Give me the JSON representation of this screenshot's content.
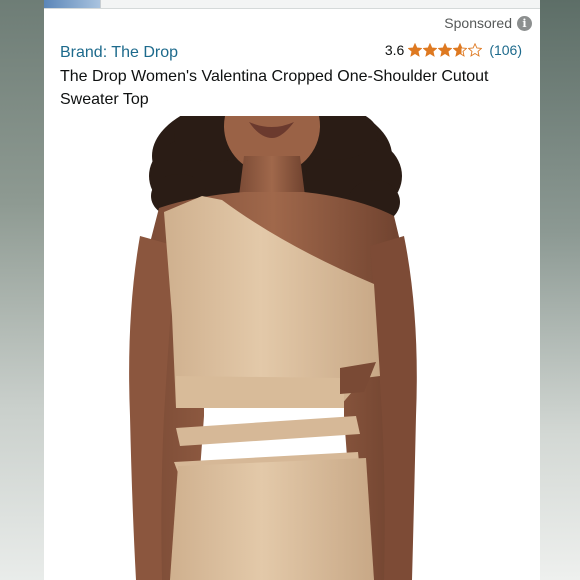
{
  "listing": {
    "sponsored_label": "Sponsored",
    "brand": "Brand: The Drop",
    "rating_value": "3.6",
    "rating_stars": 3.6,
    "review_count": "(106)",
    "title": "The Drop Women's Valentina Cropped One-Shoulder Cutout Sweater Top",
    "info_icon": "info-icon",
    "star_color": "#de7921",
    "link_color": "#1d6a8c",
    "garment_color": "#dcc0a0"
  }
}
